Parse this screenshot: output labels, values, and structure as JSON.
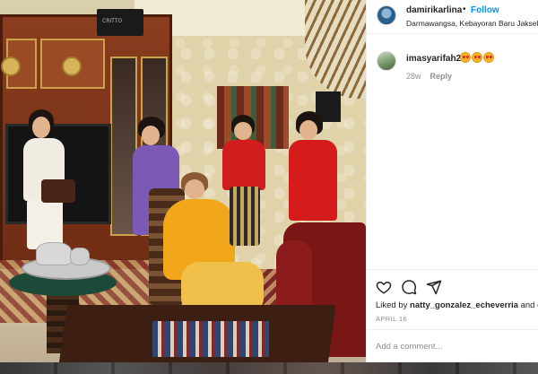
{
  "post": {
    "username": "damirikarlina",
    "separator": "•",
    "follow_label": "Follow",
    "location": "Darmawangsa, Kebayoran Baru Jaksel"
  },
  "comments": [
    {
      "username": "imasyarifah2",
      "reaction_icons": [
        "heart-eyes-emoji",
        "heart-eyes-emoji",
        "heart-eyes-emoji"
      ],
      "age": "28w",
      "reply_label": "Reply"
    }
  ],
  "actions": {
    "icons": [
      "heart-icon",
      "comment-icon",
      "share-icon"
    ],
    "liked_by_prefix": "Liked by ",
    "liked_by_user": "natty_gonzalez_echeverria",
    "liked_by_suffix": " and ot",
    "date": "APRIL 16",
    "add_comment_placeholder": "Add a comment..."
  },
  "photo": {
    "speaker_label": "CRITTO"
  },
  "colors": {
    "link": "#0095f6",
    "text": "#262626",
    "muted": "#8e8e8e",
    "border": "#efefef"
  }
}
